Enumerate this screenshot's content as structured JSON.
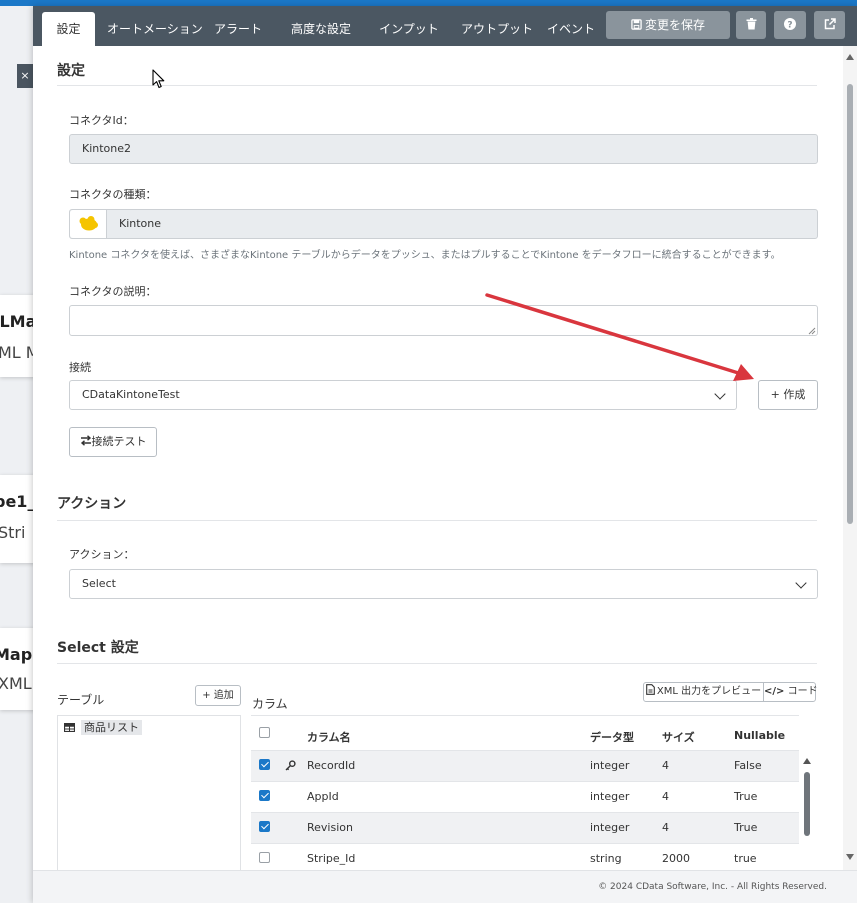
{
  "background": {
    "close_label": "×",
    "cards": [
      {
        "title": "lLMa",
        "subtitle": "ML M"
      },
      {
        "title": "pe1_",
        "subtitle": "Stri"
      },
      {
        "title": "Map",
        "subtitle": "XML"
      }
    ]
  },
  "tabs": [
    {
      "label": "設定",
      "active": true
    },
    {
      "label": "オートメーション"
    },
    {
      "label": "アラート"
    },
    {
      "label": "高度な設定"
    },
    {
      "label": "インプット"
    },
    {
      "label": "アウトプット"
    },
    {
      "label": "イベント"
    }
  ],
  "toolbar": {
    "save_icon": "floppy-disk-icon",
    "save_label": "変更を保存",
    "delete_icon": "trash-icon",
    "help_icon": "question-icon",
    "popout_icon": "external-link-icon"
  },
  "settings": {
    "title": "設定",
    "connector_id_label": "コネクタId：",
    "connector_id_value": "Kintone2",
    "connector_type_label": "コネクタの種類：",
    "connector_type_value": "Kintone",
    "connector_type_help": "Kintone コネクタを使えば、さまざまなKintone テーブルからデータをプッシュ、またはプルすることでKintone をデータフローに統合することができます。",
    "description_label": "コネクタの説明：",
    "description_value": "",
    "connection_label": "接続",
    "connection_value": "CDataKintoneTest",
    "create_button": "+ 作成",
    "test_button": "接続テスト"
  },
  "action": {
    "title": "アクション",
    "action_label": "アクション：",
    "action_value": "Select"
  },
  "select_settings": {
    "title": "Select 設定",
    "table_header": "テーブル",
    "add_button": "+ 追加",
    "tables": [
      "商品リスト"
    ],
    "columns_header": "カラム",
    "preview_button": "XML 出力をプレビュー",
    "code_button": "コード",
    "columns": {
      "headers": [
        "カラム名",
        "データ型",
        "サイズ",
        "Nullable"
      ],
      "rows": [
        {
          "checked": true,
          "key": true,
          "name": "RecordId",
          "type": "integer",
          "size": "4",
          "nullable": "False"
        },
        {
          "checked": true,
          "key": false,
          "name": "AppId",
          "type": "integer",
          "size": "4",
          "nullable": "True"
        },
        {
          "checked": true,
          "key": false,
          "name": "Revision",
          "type": "integer",
          "size": "4",
          "nullable": "True"
        },
        {
          "checked": false,
          "key": false,
          "name": "Stripe_Id",
          "type": "string",
          "size": "2000",
          "nullable": "true"
        }
      ]
    }
  },
  "footer": {
    "copyright": "© 2024 CData Software, Inc. - All Rights Reserved."
  },
  "colors": {
    "tabbar": "#4b5762",
    "accent": "#1b78c8",
    "arrow": "#d9363e"
  }
}
